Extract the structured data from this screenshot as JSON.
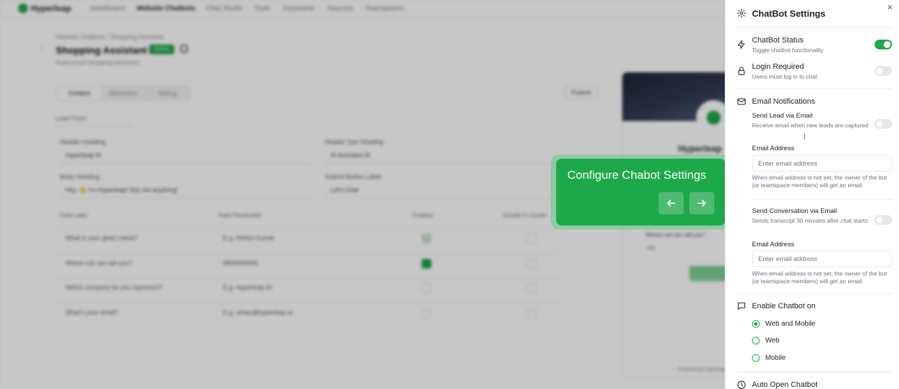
{
  "background": {
    "brand": "Hyperleap",
    "nav": [
      "Dashboard",
      "Website Chatbots",
      "Chat Studio",
      "Tools",
      "Assistants",
      "Sources",
      "Teamspaces"
    ],
    "breadcrumb": "Website Chatbots / Shopping Assistant",
    "page_title": "Shopping Assistant",
    "status_badge": "Active",
    "subtitle": "A personal shopping assistant",
    "tabs": [
      "Content",
      "Behaviour",
      "Styling"
    ],
    "publish_label": "Publish",
    "lead_form_select": "Lead Form",
    "fields": [
      {
        "label": "Header Heading",
        "value": "Hyperleap AI"
      },
      {
        "label": "Header Sub Heading",
        "value": "AI Assistant AI"
      },
      {
        "label": "Body Heading",
        "value": "Hey 👋 I'm Hyperleap! Ask me anything!"
      },
      {
        "label": "Submit Button Label",
        "value": "Let's Chat"
      }
    ],
    "table_headers": [
      "Field Label",
      "Field Placeholder",
      "Enabled",
      "Include in counter"
    ],
    "table_rows": [
      {
        "label": "What is your given name?",
        "placeholder": "E.g. Rohan Kumar"
      },
      {
        "label": "Where can we call you?",
        "placeholder": "9800000000"
      },
      {
        "label": "Which company do you represent?",
        "placeholder": "E.g. Hyperleap AI"
      },
      {
        "label": "What's your email?",
        "placeholder": "E.g. rohan@hyperleap.ai"
      }
    ],
    "preview_name": "Hyperleap",
    "preview_question": "Where can we call you?",
    "preview_chip": "+91",
    "preview_footer": "Powered by Hyperleap"
  },
  "tour": {
    "title": "Configure Chabot Settings",
    "prev_icon": "arrow-left-icon",
    "next_icon": "arrow-right-icon"
  },
  "panel": {
    "title": "ChatBot Settings",
    "close": "×",
    "status": {
      "title": "ChatBot Status",
      "desc": "Toggle chatbot functionality",
      "on": true
    },
    "login": {
      "title": "Login Required",
      "desc": "Users must log in to chat",
      "on": false
    },
    "email_notifications": {
      "title": "Email Notifications",
      "lead": {
        "title": "Send Lead via Email",
        "desc": "Receive email when new leads are captured",
        "on": false,
        "email_label": "Email Address",
        "placeholder": "Enter email address",
        "hint": "When email address is not set, the owner of the bot (or teamspace members) will get an email."
      },
      "conversation": {
        "title": "Send Conversation via Email",
        "desc": "Sends transcript 30 minutes after chat starts",
        "on": false,
        "email_label": "Email Address",
        "placeholder": "Enter email address",
        "hint": "When email address is not set, the owner of the bot (or teamspace members) will get an email."
      }
    },
    "enable_on": {
      "title": "Enable Chatbot on",
      "options": [
        "Web and Mobile",
        "Web",
        "Mobile"
      ],
      "selected": "Web and Mobile"
    },
    "auto_open": {
      "title": "Auto Open Chatbot"
    }
  },
  "colors": {
    "accent": "#1da84a",
    "text": "#222222",
    "muted": "#6b7280"
  }
}
